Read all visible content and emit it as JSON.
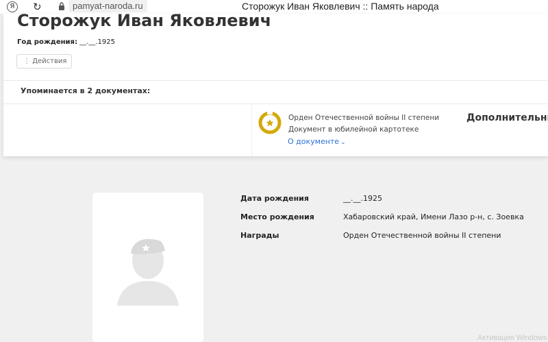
{
  "browser": {
    "ya_logo": "Я",
    "url": "pamyat-naroda.ru",
    "tab_title": "Сторожук Иван Яковлевич :: Память народа"
  },
  "person": {
    "name": "Сторожук Иван Яковлевич",
    "birth_label": "Год рождения:",
    "birth_value": "__.__.1925",
    "actions_label": "Действия"
  },
  "mentions": {
    "heading": "Упоминается в 2 документах:"
  },
  "document": {
    "title": "Орден Отечественной войны II степени Документ в юбилейной картотеке",
    "link": "О документе",
    "extra_heading": "Дополнительны"
  },
  "details": [
    {
      "label": "Дата рождения",
      "value": "__.__.1925"
    },
    {
      "label": "Место рождения",
      "value": "Хабаровский край, Имени Лазо р-н, с. Зоевка"
    },
    {
      "label": "Награды",
      "value": "Орден Отечественной войны II степени"
    }
  ],
  "watermark": "Активация Windows",
  "colors": {
    "link": "#2a6fd6",
    "medal": "#d4a80a",
    "background": "#f0f0f0"
  }
}
